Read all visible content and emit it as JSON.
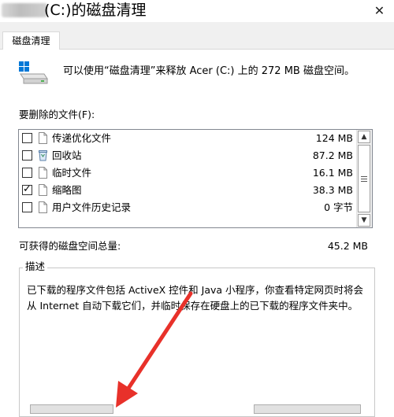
{
  "window": {
    "title": "(C:)的磁盘清理",
    "close_glyph": "✕"
  },
  "tabs": [
    {
      "label": "磁盘清理"
    }
  ],
  "header": {
    "description": "可以使用“磁盘清理”来释放 Acer (C:) 上的 272 MB 磁盘空间。"
  },
  "files": {
    "label": "要删除的文件(F):",
    "items": [
      {
        "name": "传递优化文件",
        "size": "124 MB",
        "checked": false,
        "icon": "file-icon"
      },
      {
        "name": "回收站",
        "size": "87.2 MB",
        "checked": false,
        "icon": "recycle-bin-icon"
      },
      {
        "name": "临时文件",
        "size": "16.1 MB",
        "checked": false,
        "icon": "file-icon"
      },
      {
        "name": "缩略图",
        "size": "38.3 MB",
        "checked": true,
        "icon": "file-icon"
      },
      {
        "name": "用户文件历史记录",
        "size": "0 字节",
        "checked": false,
        "icon": "file-icon"
      }
    ],
    "check_glyph": "✓"
  },
  "total": {
    "label": "可获得的磁盘空间总量:",
    "value": "45.2 MB"
  },
  "description": {
    "legend": "描述",
    "text": "已下载的程序文件包括 ActiveX 控件和 Java 小程序，你查看特定网页时将会从 Internet 自动下载它们，并临时保存在硬盘上的已下载的程序文件夹中。"
  },
  "colors": {
    "annotation_arrow": "#e8312a",
    "windows_logo": "#0078d7"
  }
}
